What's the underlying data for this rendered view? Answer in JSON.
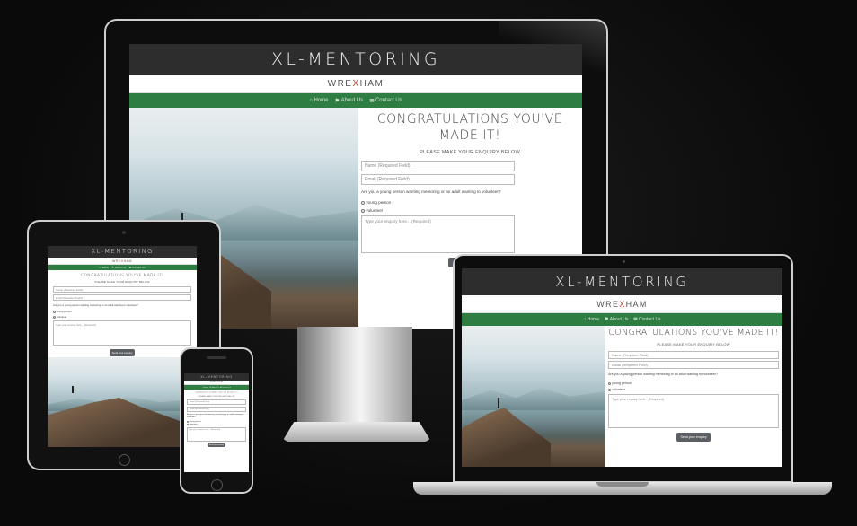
{
  "site": {
    "title": "XL-MENTORING",
    "subtitle_pre": "WRE",
    "subtitle_x": "X",
    "subtitle_post": "HAM",
    "nav": [
      {
        "label": "Home",
        "icon": "home-icon"
      },
      {
        "label": "About Us",
        "icon": "flag-icon"
      },
      {
        "label": "Contact Us",
        "icon": "mail-icon"
      }
    ],
    "heading_monitor_line1": "CONGRATULATIONS YOU'VE",
    "heading_monitor_line2": "MADE IT!",
    "heading_laptop": "CONGRATULATIONS YOU'VE MADE IT!",
    "heading_tablet": "CONGRATULATIONS YOU'VE MADE IT!",
    "heading_phone": "CONGRATULATIONS YOU'VE MADE IT!",
    "prompt": "PLEASE MAKE YOUR ENQUIRY BELOW",
    "name_placeholder": "Name (Required Field)",
    "email_placeholder": "Email (Required Field)",
    "question": "Are you a young person wanting mentoring or an adult wanting to volunteer?",
    "options": [
      "young person",
      "volunteer"
    ],
    "enquiry_placeholder": "Type your enquiry here... (Required)",
    "submit_label": "Send your enquiry"
  },
  "colors": {
    "header_bg": "#2d2d2d",
    "nav_bg": "#2e7d43",
    "accent_x": "#c0392b",
    "button_bg": "#5b5f63"
  }
}
